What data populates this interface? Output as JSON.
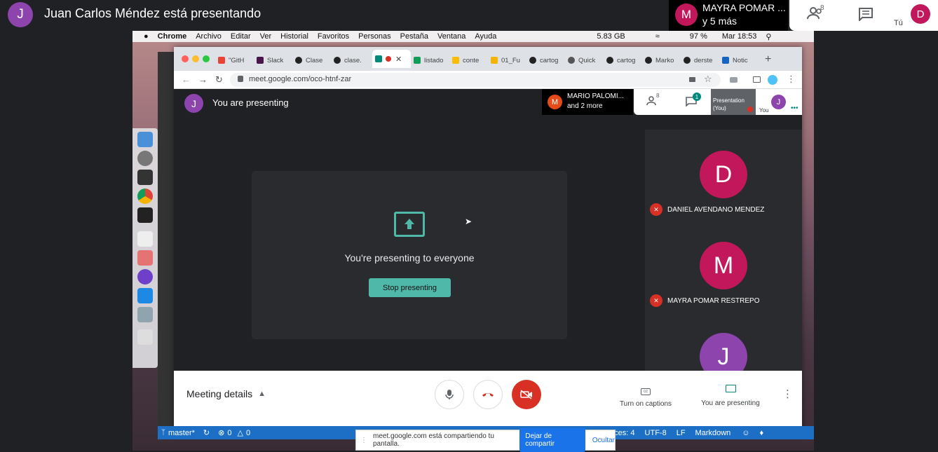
{
  "meet_outer": {
    "presenter_initial": "J",
    "presenter_text": "Juan Carlos Méndez está presentando",
    "participant_initial": "M",
    "participant_name": "MAYRA POMAR ...",
    "participant_more": "y 5 más",
    "people_count": "8",
    "me_initial": "D",
    "me_label": "Tú"
  },
  "macos_menu": {
    "app": "Chrome",
    "items": [
      "Archivo",
      "Editar",
      "Ver",
      "Historial",
      "Favoritos",
      "Personas",
      "Pestaña",
      "Ventana",
      "Ayuda"
    ],
    "memory": "5.83 GB",
    "battery": "97 %",
    "clock": "Mar 18:53"
  },
  "tabs": [
    {
      "label": "\"GitH"
    },
    {
      "label": "Slack"
    },
    {
      "label": "Clase"
    },
    {
      "label": "clase."
    },
    {
      "label": ""
    },
    {
      "label": "listado"
    },
    {
      "label": "conte"
    },
    {
      "label": "01_Fu"
    },
    {
      "label": "cartog"
    },
    {
      "label": "Quick"
    },
    {
      "label": "cartog"
    },
    {
      "label": "Marko"
    },
    {
      "label": "derste"
    },
    {
      "label": "Notic"
    }
  ],
  "omnibox": {
    "url": "meet.google.com/oco-htnf-zar"
  },
  "inner_meet": {
    "presenter_initial": "J",
    "presenting_label": "You are presenting",
    "participant_initial": "M",
    "participant_name": "MARIO PALOMI...",
    "participant_more": "and 2 more",
    "people_count": "8",
    "chat_count": "1",
    "tile_label_1": "Presentation",
    "tile_label_2": "(You)",
    "self_initial": "J",
    "self_label": "You"
  },
  "presenting_card": {
    "text": "You're presenting to everyone",
    "button": "Stop presenting"
  },
  "participants": [
    {
      "initial": "D",
      "name": "DANIEL AVENDANO MENDEZ",
      "color": "#c2185b"
    },
    {
      "initial": "M",
      "name": "MAYRA POMAR RESTREPO",
      "color": "#c2185b"
    },
    {
      "initial": "J",
      "name": "",
      "color": "#8e44ad"
    }
  ],
  "bottom_bar": {
    "meeting_details": "Meeting details",
    "captions": "Turn on captions",
    "presenting": "You are presenting"
  },
  "vscode_status": {
    "branch": "master*",
    "errors": "0",
    "warnings": "0",
    "spaces": "aces: 4",
    "encoding": "UTF-8",
    "eol": "LF",
    "language": "Markdown"
  },
  "share_bar": {
    "message": "meet.google.com está compartiendo tu pantalla.",
    "stop_button": "Dejar de compartir",
    "hide_button": "Ocultar"
  },
  "colors": {
    "meet_teal": "#4fb8a8",
    "hangup_red": "#d93025",
    "chrome_blue": "#1a73e8"
  }
}
